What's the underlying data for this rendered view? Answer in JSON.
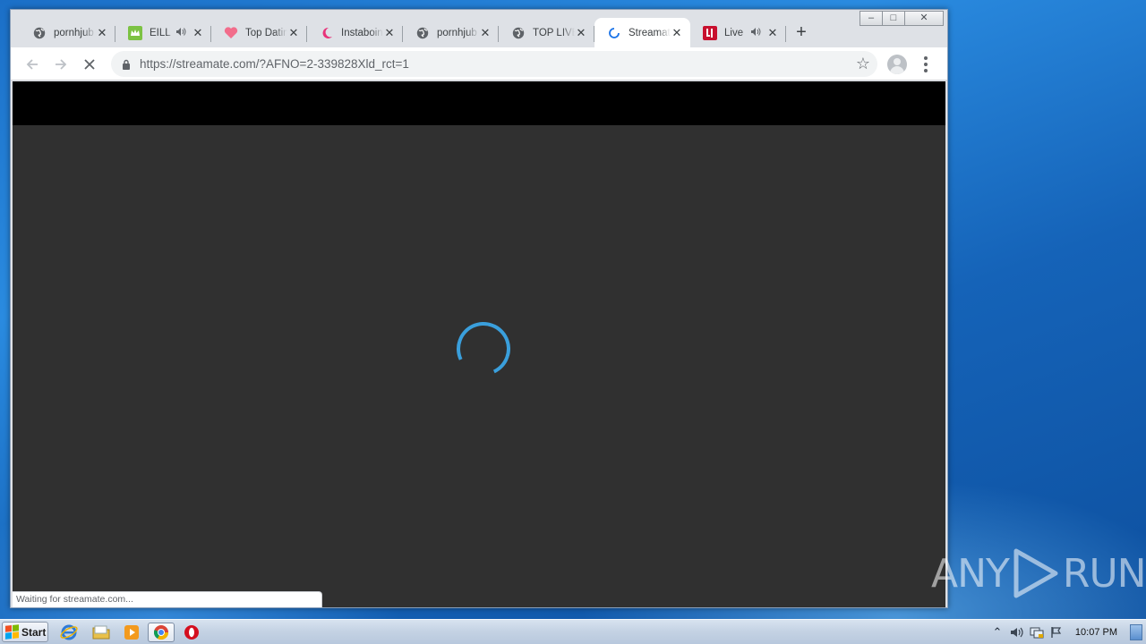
{
  "browser": {
    "tabs": [
      {
        "title": "pornhjub",
        "icon": "globe-icon",
        "audio": false,
        "active": false
      },
      {
        "title": "EILL",
        "icon": "crown-icon",
        "audio": true,
        "active": false
      },
      {
        "title": "Top Dating",
        "icon": "heart-icon",
        "audio": false,
        "active": false
      },
      {
        "title": "Instaboink",
        "icon": "crescent-icon",
        "audio": false,
        "active": false
      },
      {
        "title": "pornhjub",
        "icon": "globe-icon",
        "audio": false,
        "active": false
      },
      {
        "title": "TOP LIVE",
        "icon": "globe-icon",
        "audio": false,
        "active": false
      },
      {
        "title": "Streamate",
        "icon": "loading-icon",
        "audio": false,
        "active": true
      },
      {
        "title": "Live",
        "icon": "brand-logo-icon",
        "audio": true,
        "active": false
      }
    ],
    "tab_close_glyph": "✕",
    "new_tab_glyph": "+",
    "url": "https://streamate.com/?AFNO=2-339828Xld_rct=1",
    "status_text": "Waiting for streamate.com...",
    "window_controls": {
      "minimize": "–",
      "maximize": "□",
      "close": "✕"
    }
  },
  "watermark": {
    "left": "ANY",
    "right": "RUN"
  },
  "taskbar": {
    "start_label": "Start",
    "clock": "10:07 PM"
  },
  "colors": {
    "spinner": "#3a9fdc",
    "page_bg": "#303030",
    "page_header": "#000000"
  }
}
